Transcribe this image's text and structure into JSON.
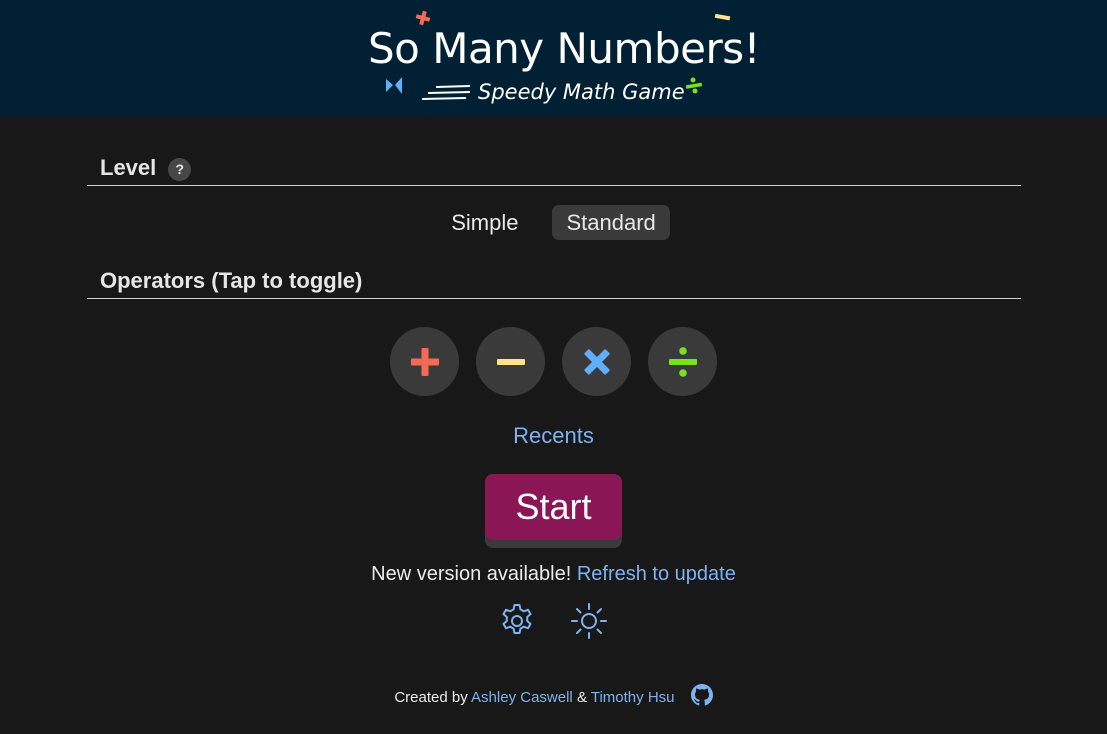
{
  "header": {
    "title": "So Many Numbers!",
    "subtitle": "Speedy Math Game"
  },
  "level": {
    "heading": "Level",
    "help_label": "?",
    "options": [
      "Simple",
      "Standard"
    ],
    "selected": "Standard"
  },
  "operators": {
    "heading": "Operators (Tap to toggle)",
    "items": [
      {
        "name": "plus",
        "color": "#f56a55"
      },
      {
        "name": "minus",
        "color": "#ffe28e"
      },
      {
        "name": "times",
        "color": "#61aef9"
      },
      {
        "name": "divide",
        "color": "#79e21e"
      }
    ]
  },
  "recents_label": "Recents",
  "start_label": "Start",
  "update": {
    "message": "New version available!",
    "link": "Refresh to update"
  },
  "footer": {
    "prefix": "Created by",
    "author1": "Ashley Caswell",
    "amp": "&",
    "author2": "Timothy Hsu"
  },
  "colors": {
    "header_bg": "#012034",
    "page_bg": "#181818",
    "accent_link": "#7fb2f0",
    "start_bg": "#8b1655"
  }
}
